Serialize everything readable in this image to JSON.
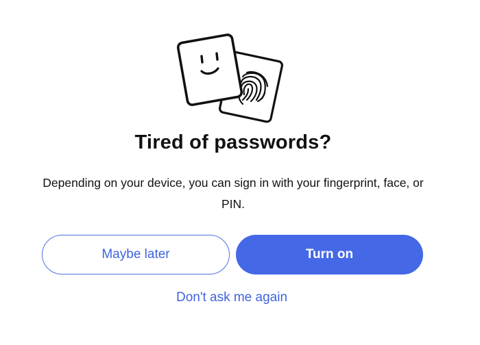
{
  "dialog": {
    "title": "Tired of passwords?",
    "body": "Depending on your device, you can sign in with your fingerprint, face, or PIN.",
    "secondary_button_label": "Maybe later",
    "primary_button_label": "Turn on",
    "dismiss_link_label": "Don't ask me again"
  },
  "illustration": {
    "front_card_icon": "smiley-face-icon",
    "back_card_icon": "fingerprint-icon"
  },
  "colors": {
    "accent": "#4468e6",
    "link": "#3f63e0",
    "text": "#111111",
    "background": "#ffffff"
  }
}
